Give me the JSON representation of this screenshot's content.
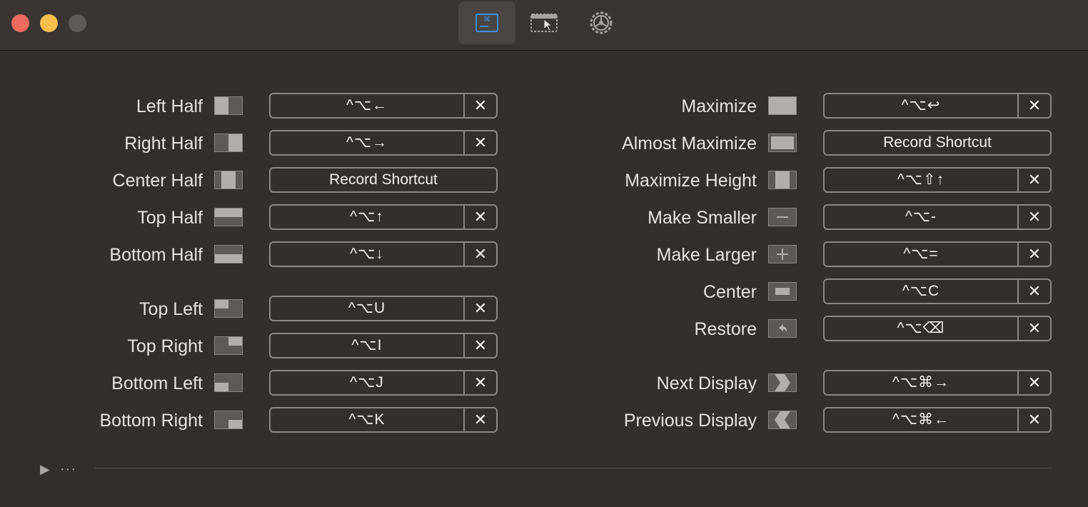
{
  "tabs": [
    {
      "name": "keyboard-shortcuts-icon",
      "selected": true
    },
    {
      "name": "snap-areas-icon",
      "selected": false
    },
    {
      "name": "settings-gear-icon",
      "selected": false
    }
  ],
  "record_label": "Record Shortcut",
  "clear_glyph": "✕",
  "left_actions": [
    {
      "id": "left-half",
      "label": "Left Half",
      "shortcut": "^⌥←"
    },
    {
      "id": "right-half",
      "label": "Right Half",
      "shortcut": "^⌥→"
    },
    {
      "id": "center-half",
      "label": "Center Half",
      "shortcut": ""
    },
    {
      "id": "top-half",
      "label": "Top Half",
      "shortcut": "^⌥↑"
    },
    {
      "id": "bottom-half",
      "label": "Bottom Half",
      "shortcut": "^⌥↓"
    },
    {
      "id": "top-left",
      "label": "Top Left",
      "shortcut": "^⌥U"
    },
    {
      "id": "top-right",
      "label": "Top Right",
      "shortcut": "^⌥I"
    },
    {
      "id": "bottom-left",
      "label": "Bottom Left",
      "shortcut": "^⌥J"
    },
    {
      "id": "bottom-right",
      "label": "Bottom Right",
      "shortcut": "^⌥K"
    }
  ],
  "right_actions": [
    {
      "id": "maximize",
      "label": "Maximize",
      "shortcut": "^⌥↩"
    },
    {
      "id": "almost-maximize",
      "label": "Almost Maximize",
      "shortcut": ""
    },
    {
      "id": "maximize-height",
      "label": "Maximize Height",
      "shortcut": "^⌥⇧↑"
    },
    {
      "id": "make-smaller",
      "label": "Make Smaller",
      "shortcut": "^⌥-"
    },
    {
      "id": "make-larger",
      "label": "Make Larger",
      "shortcut": "^⌥="
    },
    {
      "id": "center",
      "label": "Center",
      "shortcut": "^⌥C"
    },
    {
      "id": "restore",
      "label": "Restore",
      "shortcut": "^⌥⌫"
    },
    {
      "id": "next-display",
      "label": "Next Display",
      "shortcut": "^⌥⌘→"
    },
    {
      "id": "previous-display",
      "label": "Previous Display",
      "shortcut": "^⌥⌘←"
    }
  ],
  "footer": {
    "play_glyph": "▶",
    "more_glyph": "···"
  }
}
